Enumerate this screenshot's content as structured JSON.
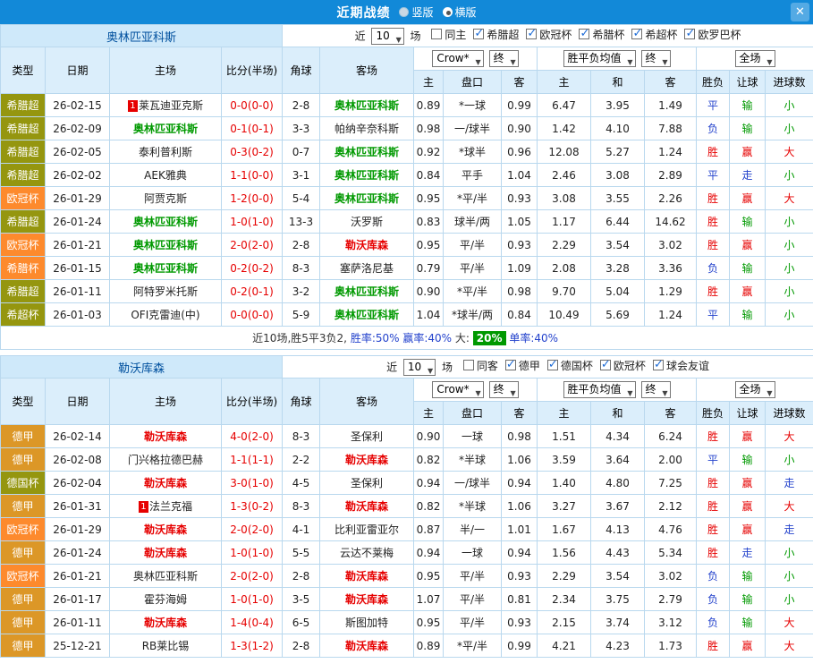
{
  "titlebar": {
    "title": "近期战绩",
    "radio_vertical": "竖版",
    "radio_horizontal": "横版",
    "close": "✕"
  },
  "columns": [
    "类型",
    "日期",
    "主场",
    "比分(半场)",
    "角球",
    "客场",
    "主",
    "盘口",
    "客",
    "主",
    "和",
    "客",
    "胜负",
    "让球",
    "进球数"
  ],
  "colors": {
    "titlebar_bg": "#1289d8",
    "header_bg": "#dbeefb",
    "strip_bg": "#cfe9fa",
    "border": "#b9d8ee",
    "red": "#e60000",
    "blue": "#2342cc",
    "green": "#009900"
  },
  "sections": [
    {
      "team": "奥林匹亚科斯",
      "near_label": "近",
      "games_value": "10",
      "games_label": "场",
      "checkboxes": [
        {
          "label": "同主",
          "checked": false
        },
        {
          "label": "希腊超",
          "checked": true
        },
        {
          "label": "欧冠杯",
          "checked": true
        },
        {
          "label": "希腊杯",
          "checked": true
        },
        {
          "label": "希超杯",
          "checked": true
        },
        {
          "label": "欧罗巴杯",
          "checked": true
        }
      ],
      "selects": {
        "company": "Crow*",
        "company_time": "终",
        "europe": "胜平负均值",
        "europe_time": "终",
        "scope": "全场"
      },
      "rows": [
        {
          "type": "希腊超",
          "type_bg": "#95960f",
          "date": "26-02-15",
          "home": "莱瓦迪亚克斯",
          "home_badge": "1",
          "home_c": "",
          "score": "0-0(0-0)",
          "corners": "2-8",
          "away": "奥林匹亚科斯",
          "away_badge": "",
          "away_c": "green",
          "h": "0.89",
          "handicap": "*一球",
          "a": "0.99",
          "w": "6.47",
          "d": "3.95",
          "l": "1.49",
          "result": "平",
          "result_c": "blue",
          "give": "输",
          "give_c": "green",
          "goal": "小",
          "goal_c": "green"
        },
        {
          "type": "希腊超",
          "type_bg": "#95960f",
          "date": "26-02-09",
          "home": "奥林匹亚科斯",
          "home_badge": "",
          "home_c": "green",
          "score": "0-1(0-1)",
          "corners": "3-3",
          "away": "帕纳辛奈科斯",
          "away_badge": "",
          "away_c": "",
          "h": "0.98",
          "handicap": "一/球半",
          "a": "0.90",
          "w": "1.42",
          "d": "4.10",
          "l": "7.88",
          "result": "负",
          "result_c": "blue",
          "give": "输",
          "give_c": "green",
          "goal": "小",
          "goal_c": "green"
        },
        {
          "type": "希腊超",
          "type_bg": "#95960f",
          "date": "26-02-05",
          "home": "泰利普利斯",
          "home_badge": "",
          "home_c": "",
          "score": "0-3(0-2)",
          "corners": "0-7",
          "away": "奥林匹亚科斯",
          "away_badge": "",
          "away_c": "green",
          "h": "0.92",
          "handicap": "*球半",
          "a": "0.96",
          "w": "12.08",
          "d": "5.27",
          "l": "1.24",
          "result": "胜",
          "result_c": "red",
          "give": "赢",
          "give_c": "red",
          "goal": "大",
          "goal_c": "red"
        },
        {
          "type": "希腊超",
          "type_bg": "#95960f",
          "date": "26-02-02",
          "home": "AEK雅典",
          "home_badge": "",
          "home_c": "",
          "score": "1-1(0-0)",
          "corners": "3-1",
          "away": "奥林匹亚科斯",
          "away_badge": "",
          "away_c": "green",
          "h": "0.84",
          "handicap": "平手",
          "a": "1.04",
          "w": "2.46",
          "d": "3.08",
          "l": "2.89",
          "result": "平",
          "result_c": "blue",
          "give": "走",
          "give_c": "blue",
          "goal": "小",
          "goal_c": "green"
        },
        {
          "type": "欧冠杯",
          "type_bg": "#fd8a2d",
          "date": "26-01-29",
          "home": "阿贾克斯",
          "home_badge": "",
          "home_c": "",
          "score": "1-2(0-0)",
          "corners": "5-4",
          "away": "奥林匹亚科斯",
          "away_badge": "",
          "away_c": "green",
          "h": "0.95",
          "handicap": "*平/半",
          "a": "0.93",
          "w": "3.08",
          "d": "3.55",
          "l": "2.26",
          "result": "胜",
          "result_c": "red",
          "give": "赢",
          "give_c": "red",
          "goal": "大",
          "goal_c": "red"
        },
        {
          "type": "希腊超",
          "type_bg": "#95960f",
          "date": "26-01-24",
          "home": "奥林匹亚科斯",
          "home_badge": "",
          "home_c": "green",
          "score": "1-0(1-0)",
          "corners": "13-3",
          "away": "沃罗斯",
          "away_badge": "",
          "away_c": "",
          "h": "0.83",
          "handicap": "球半/两",
          "a": "1.05",
          "w": "1.17",
          "d": "6.44",
          "l": "14.62",
          "result": "胜",
          "result_c": "red",
          "give": "输",
          "give_c": "green",
          "goal": "小",
          "goal_c": "green"
        },
        {
          "type": "欧冠杯",
          "type_bg": "#fd8a2d",
          "date": "26-01-21",
          "home": "奥林匹亚科斯",
          "home_badge": "",
          "home_c": "green",
          "score": "2-0(2-0)",
          "corners": "2-8",
          "away": "勒沃库森",
          "away_badge": "",
          "away_c": "red",
          "h": "0.95",
          "handicap": "平/半",
          "a": "0.93",
          "w": "2.29",
          "d": "3.54",
          "l": "3.02",
          "result": "胜",
          "result_c": "red",
          "give": "赢",
          "give_c": "red",
          "goal": "小",
          "goal_c": "green"
        },
        {
          "type": "希腊杯",
          "type_bg": "#fd8a2d",
          "date": "26-01-15",
          "home": "奥林匹亚科斯",
          "home_badge": "",
          "home_c": "green",
          "score": "0-2(0-2)",
          "corners": "8-3",
          "away": "塞萨洛尼基",
          "away_badge": "",
          "away_c": "",
          "h": "0.79",
          "handicap": "平/半",
          "a": "1.09",
          "w": "2.08",
          "d": "3.28",
          "l": "3.36",
          "result": "负",
          "result_c": "blue",
          "give": "输",
          "give_c": "green",
          "goal": "小",
          "goal_c": "green"
        },
        {
          "type": "希腊超",
          "type_bg": "#95960f",
          "date": "26-01-11",
          "home": "阿特罗米托斯",
          "home_badge": "",
          "home_c": "",
          "score": "0-2(0-1)",
          "corners": "3-2",
          "away": "奥林匹亚科斯",
          "away_badge": "",
          "away_c": "green",
          "h": "0.90",
          "handicap": "*平/半",
          "a": "0.98",
          "w": "9.70",
          "d": "5.04",
          "l": "1.29",
          "result": "胜",
          "result_c": "red",
          "give": "赢",
          "give_c": "red",
          "goal": "小",
          "goal_c": "green"
        },
        {
          "type": "希超杯",
          "type_bg": "#95960f",
          "date": "26-01-03",
          "home": "OFI克雷迪(中)",
          "home_badge": "",
          "home_c": "",
          "score": "0-0(0-0)",
          "corners": "5-9",
          "away": "奥林匹亚科斯",
          "away_badge": "",
          "away_c": "green",
          "h": "1.04",
          "handicap": "*球半/两",
          "a": "0.84",
          "w": "10.49",
          "d": "5.69",
          "l": "1.24",
          "result": "平",
          "result_c": "blue",
          "give": "输",
          "give_c": "green",
          "goal": "小",
          "goal_c": "green"
        }
      ],
      "summary_parts": [
        {
          "text": "近10场,胜5平3负2,",
          "color": "#333333",
          "badge": false
        },
        {
          "text": "胜率:50%",
          "color": "#2342cc",
          "badge": false
        },
        {
          "text": "赢率:40%",
          "color": "#2342cc",
          "badge": false
        },
        {
          "text": "大:",
          "color": "#333333",
          "badge": false
        },
        {
          "text": "20%",
          "color": "#ffffff",
          "badge": true
        },
        {
          "text": "单率:40%",
          "color": "#2342cc",
          "badge": false
        }
      ]
    },
    {
      "team": "勒沃库森",
      "near_label": "近",
      "games_value": "10",
      "games_label": "场",
      "checkboxes": [
        {
          "label": "同客",
          "checked": false
        },
        {
          "label": "德甲",
          "checked": true
        },
        {
          "label": "德国杯",
          "checked": true
        },
        {
          "label": "欧冠杯",
          "checked": true
        },
        {
          "label": "球会友谊",
          "checked": true
        }
      ],
      "selects": {
        "company": "Crow*",
        "company_time": "终",
        "europe": "胜平负均值",
        "europe_time": "终",
        "scope": "全场"
      },
      "rows": [
        {
          "type": "德甲",
          "type_bg": "#dc9727",
          "date": "26-02-14",
          "home": "勒沃库森",
          "home_badge": "",
          "home_c": "red",
          "score": "4-0(2-0)",
          "corners": "8-3",
          "away": "圣保利",
          "away_badge": "",
          "away_c": "",
          "h": "0.90",
          "handicap": "一球",
          "a": "0.98",
          "w": "1.51",
          "d": "4.34",
          "l": "6.24",
          "result": "胜",
          "result_c": "red",
          "give": "赢",
          "give_c": "red",
          "goal": "大",
          "goal_c": "red"
        },
        {
          "type": "德甲",
          "type_bg": "#dc9727",
          "date": "26-02-08",
          "home": "门兴格拉德巴赫",
          "home_badge": "",
          "home_c": "",
          "score": "1-1(1-1)",
          "corners": "2-2",
          "away": "勒沃库森",
          "away_badge": "",
          "away_c": "red",
          "h": "0.82",
          "handicap": "*半球",
          "a": "1.06",
          "w": "3.59",
          "d": "3.64",
          "l": "2.00",
          "result": "平",
          "result_c": "blue",
          "give": "输",
          "give_c": "green",
          "goal": "小",
          "goal_c": "green"
        },
        {
          "type": "德国杯",
          "type_bg": "#95960f",
          "date": "26-02-04",
          "home": "勒沃库森",
          "home_badge": "",
          "home_c": "red",
          "score": "3-0(1-0)",
          "corners": "4-5",
          "away": "圣保利",
          "away_badge": "",
          "away_c": "",
          "h": "0.94",
          "handicap": "一/球半",
          "a": "0.94",
          "w": "1.40",
          "d": "4.80",
          "l": "7.25",
          "result": "胜",
          "result_c": "red",
          "give": "赢",
          "give_c": "red",
          "goal": "走",
          "goal_c": "blue"
        },
        {
          "type": "德甲",
          "type_bg": "#dc9727",
          "date": "26-01-31",
          "home": "法兰克福",
          "home_badge": "1",
          "home_c": "",
          "score": "1-3(0-2)",
          "corners": "8-3",
          "away": "勒沃库森",
          "away_badge": "",
          "away_c": "red",
          "h": "0.82",
          "handicap": "*半球",
          "a": "1.06",
          "w": "3.27",
          "d": "3.67",
          "l": "2.12",
          "result": "胜",
          "result_c": "red",
          "give": "赢",
          "give_c": "red",
          "goal": "大",
          "goal_c": "red"
        },
        {
          "type": "欧冠杯",
          "type_bg": "#fd8a2d",
          "date": "26-01-29",
          "home": "勒沃库森",
          "home_badge": "",
          "home_c": "red",
          "score": "2-0(2-0)",
          "corners": "4-1",
          "away": "比利亚雷亚尔",
          "away_badge": "",
          "away_c": "",
          "h": "0.87",
          "handicap": "半/一",
          "a": "1.01",
          "w": "1.67",
          "d": "4.13",
          "l": "4.76",
          "result": "胜",
          "result_c": "red",
          "give": "赢",
          "give_c": "red",
          "goal": "走",
          "goal_c": "blue"
        },
        {
          "type": "德甲",
          "type_bg": "#dc9727",
          "date": "26-01-24",
          "home": "勒沃库森",
          "home_badge": "",
          "home_c": "red",
          "score": "1-0(1-0)",
          "corners": "5-5",
          "away": "云达不莱梅",
          "away_badge": "",
          "away_c": "",
          "h": "0.94",
          "handicap": "一球",
          "a": "0.94",
          "w": "1.56",
          "d": "4.43",
          "l": "5.34",
          "result": "胜",
          "result_c": "red",
          "give": "走",
          "give_c": "blue",
          "goal": "小",
          "goal_c": "green"
        },
        {
          "type": "欧冠杯",
          "type_bg": "#fd8a2d",
          "date": "26-01-21",
          "home": "奥林匹亚科斯",
          "home_badge": "",
          "home_c": "",
          "score": "2-0(2-0)",
          "corners": "2-8",
          "away": "勒沃库森",
          "away_badge": "",
          "away_c": "red",
          "h": "0.95",
          "handicap": "平/半",
          "a": "0.93",
          "w": "2.29",
          "d": "3.54",
          "l": "3.02",
          "result": "负",
          "result_c": "blue",
          "give": "输",
          "give_c": "green",
          "goal": "小",
          "goal_c": "green"
        },
        {
          "type": "德甲",
          "type_bg": "#dc9727",
          "date": "26-01-17",
          "home": "霍芬海姆",
          "home_badge": "",
          "home_c": "",
          "score": "1-0(1-0)",
          "corners": "3-5",
          "away": "勒沃库森",
          "away_badge": "",
          "away_c": "red",
          "h": "1.07",
          "handicap": "平/半",
          "a": "0.81",
          "w": "2.34",
          "d": "3.75",
          "l": "2.79",
          "result": "负",
          "result_c": "blue",
          "give": "输",
          "give_c": "green",
          "goal": "小",
          "goal_c": "green"
        },
        {
          "type": "德甲",
          "type_bg": "#dc9727",
          "date": "26-01-11",
          "home": "勒沃库森",
          "home_badge": "",
          "home_c": "red",
          "score": "1-4(0-4)",
          "corners": "6-5",
          "away": "斯图加特",
          "away_badge": "",
          "away_c": "",
          "h": "0.95",
          "handicap": "平/半",
          "a": "0.93",
          "w": "2.15",
          "d": "3.74",
          "l": "3.12",
          "result": "负",
          "result_c": "blue",
          "give": "输",
          "give_c": "green",
          "goal": "大",
          "goal_c": "red"
        },
        {
          "type": "德甲",
          "type_bg": "#dc9727",
          "date": "25-12-21",
          "home": "RB莱比锡",
          "home_badge": "",
          "home_c": "",
          "score": "1-3(1-2)",
          "corners": "2-8",
          "away": "勒沃库森",
          "away_badge": "",
          "away_c": "red",
          "h": "0.89",
          "handicap": "*平/半",
          "a": "0.99",
          "w": "4.21",
          "d": "4.23",
          "l": "1.73",
          "result": "胜",
          "result_c": "red",
          "give": "赢",
          "give_c": "red",
          "goal": "大",
          "goal_c": "red"
        }
      ],
      "summary_parts": []
    }
  ]
}
